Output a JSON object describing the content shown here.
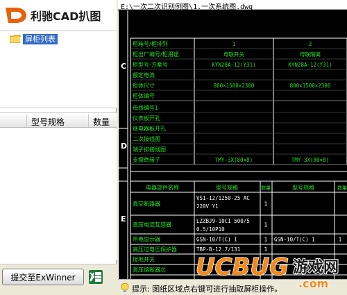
{
  "app": {
    "title": "利驰CAD扒图",
    "logo_letter": "D"
  },
  "tree": {
    "node_label": "屏柜列表"
  },
  "list": {
    "columns": [
      "",
      "型号规格",
      "数量"
    ]
  },
  "actions": {
    "submit_label": "提交至ExWinner"
  },
  "file": {
    "path": "E:\\一次二次识别例图\\1.一次系统图.dwg"
  },
  "hint": {
    "text": "提示: 图纸区域点右键可进行抽取屏柜操作。"
  },
  "drawing": {
    "section_c": "C",
    "section_d": "D",
    "section_e": "E",
    "header_rows": [
      {
        "label": "柜箱号/柜排列",
        "v1": "1",
        "v2": "2"
      },
      {
        "label": "柜出厂编号/柜用途",
        "v1": "母联开关",
        "v2": "母联隔离"
      },
      {
        "label": "柜型号-方案号",
        "v1": "KYN28A-12(Y31)",
        "v2": "KYN28A-12(Y31)"
      },
      {
        "label": "额定电流",
        "v1": "",
        "v2": ""
      },
      {
        "label": "柜体尺寸",
        "v1": "800×1500×2300",
        "v2": "800×1500×2300"
      },
      {
        "label": "柜体编号",
        "v1": "",
        "v2": ""
      }
    ],
    "mid_rows": [
      {
        "label": "母线编号1",
        "v1": "",
        "v2": ""
      },
      {
        "label": "仪表板开孔",
        "v1": "",
        "v2": ""
      },
      {
        "label": "继电器板开孔",
        "v1": "",
        "v2": ""
      },
      {
        "label": "二次接线图",
        "v1": "",
        "v2": ""
      },
      {
        "label": "端子排接线图",
        "v1": "",
        "v2": ""
      },
      {
        "label": "支撑绝缘子",
        "v1": "TMY-3X(80×8)",
        "v2": "TMY-3X(80×8)"
      }
    ],
    "component_headers": {
      "name": "电器部件名称",
      "spec1": "型号规格",
      "qty1": "数量",
      "spec2": "型号规格",
      "qty2": "数量"
    },
    "component_rows": [
      {
        "name": "真空断路器",
        "spec1": "VS1-12/1250-25 AC 220V Y1",
        "qty1": "1",
        "spec2": "",
        "qty2": ""
      },
      {
        "name": "高压电流互感器",
        "spec1": "LZZBJ9-10C1 500/5 0.5/10P10",
        "qty1": "1",
        "spec2": "",
        "qty2": ""
      },
      {
        "name": "带电显示器",
        "spec1": "GSN-10/T(C)  1",
        "qty1": "1",
        "spec2": "GSN-10/T(C)  1",
        "qty2": "1"
      },
      {
        "name": "高压过电压保护器",
        "spec1": "TBP-B-12.7/131",
        "qty1": "1",
        "spec2": "",
        "qty2": ""
      },
      {
        "name": "接地开关",
        "spec1": "",
        "qty1": "",
        "spec2": "",
        "qty2": ""
      },
      {
        "name": "高压熔断器芯",
        "spec1": "",
        "qty1": "",
        "spec2": "",
        "qty2": ""
      }
    ]
  },
  "watermark": {
    "brand": "UCBUG",
    "suffix": "游戏网",
    "domain": ".com"
  },
  "colors": {
    "cad_green": "#21e021",
    "cad_white": "#ffffff",
    "selection_blue": "#316ac5",
    "watermark_orange": "#f08a1c"
  }
}
